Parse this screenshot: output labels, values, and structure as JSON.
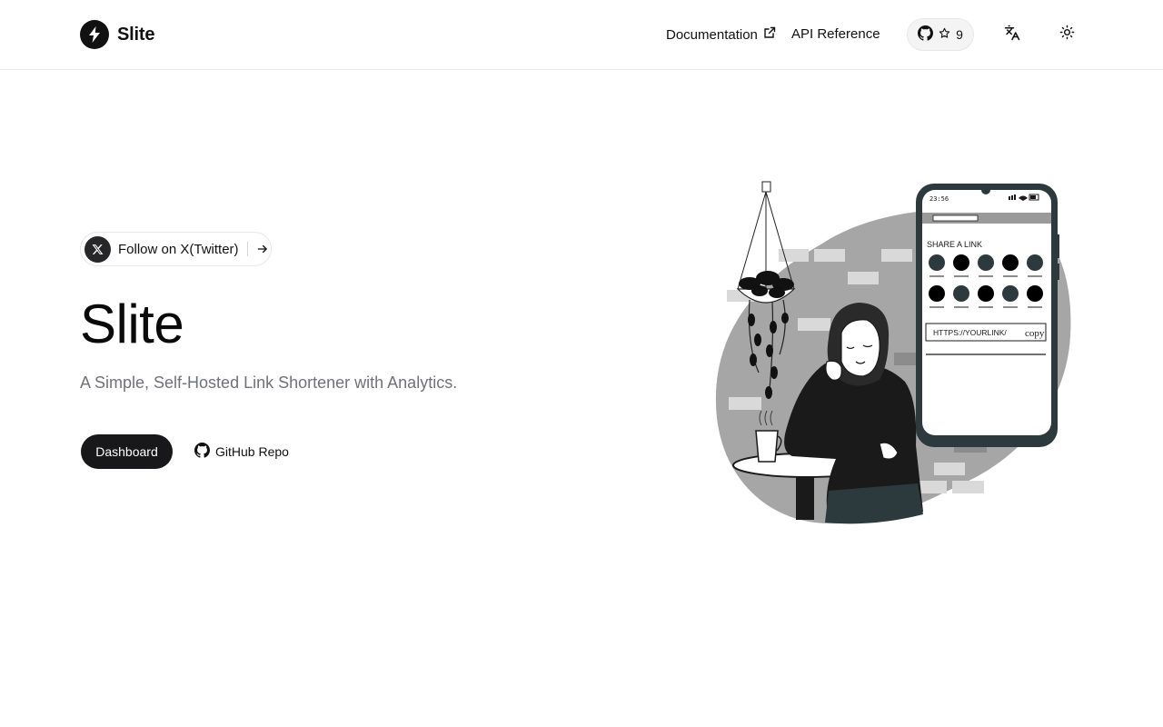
{
  "header": {
    "brand_name": "Slite",
    "nav": {
      "documentation": "Documentation",
      "api_reference": "API Reference"
    },
    "github_stars": "9",
    "icons": {
      "logo": "bolt-icon",
      "external": "external-link-icon",
      "github": "github-icon",
      "star": "star-icon",
      "language": "translate-icon",
      "theme": "sun-icon"
    }
  },
  "hero": {
    "follow_label": "Follow on X(Twitter)",
    "title": "Slite",
    "subtitle": "A Simple, Self-Hosted Link Shortener with Analytics.",
    "primary_button": "Dashboard",
    "secondary_button": "GitHub Repo"
  },
  "illustration": {
    "phone_time": "23:56",
    "heading": "SHARE A LINK",
    "url_field": "HTTPS://YOURLINK/",
    "copy_label": "copy"
  },
  "colors": {
    "text": "#111111",
    "muted": "#71717a",
    "primary_button": "#18181b",
    "border": "#e5e7eb",
    "blob": "#a3a3a3"
  }
}
